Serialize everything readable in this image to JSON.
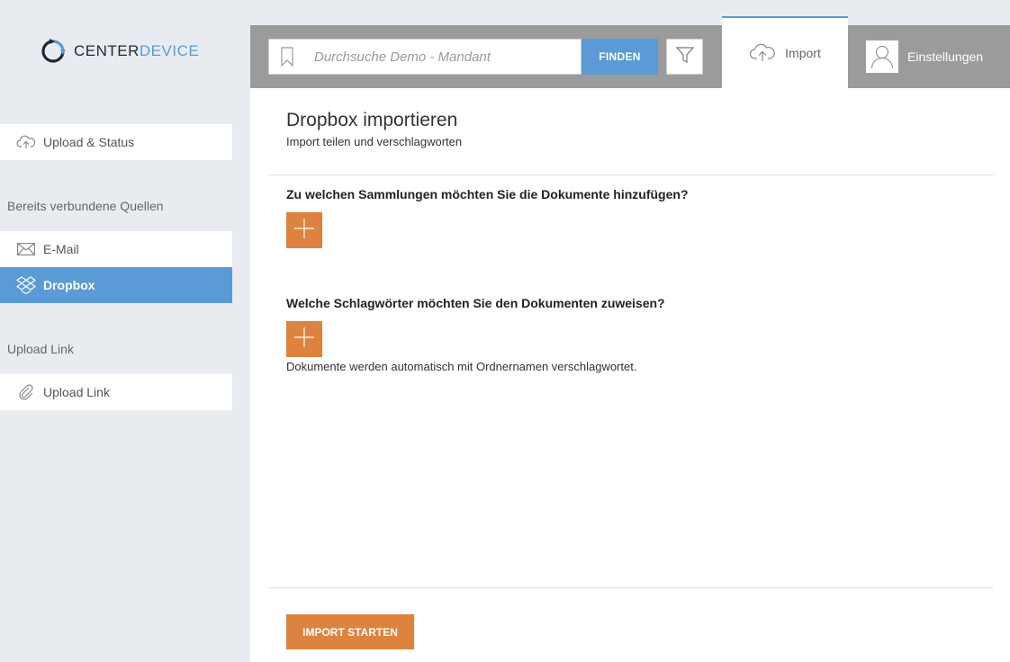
{
  "app": {
    "logo_text_a": "CENTER",
    "logo_text_b": "DEVICE",
    "accent": "#5b9bd5",
    "action": "#dd833f"
  },
  "sidebar": {
    "upload_status": "Upload & Status",
    "connected_heading": "Bereits verbundene Quellen",
    "sources": [
      {
        "label": "E-Mail",
        "icon": "envelope-icon"
      },
      {
        "label": "Dropbox",
        "icon": "dropbox-icon",
        "active": true
      }
    ],
    "upload_link_heading": "Upload Link",
    "upload_link": "Upload Link"
  },
  "topbar": {
    "search_placeholder": "Durchsuche Demo - Mandant",
    "find_label": "FINDEN",
    "import_tab": "Import",
    "settings_tab": "Einstellungen"
  },
  "main": {
    "title": "Dropbox importieren",
    "subtitle": "Import teilen und verschlagworten",
    "q_collections": "Zu welchen Sammlungen möchten Sie die Dokumente hinzufügen?",
    "q_tags": "Welche Schlagwörter möchten Sie den Dokumenten zuweisen?",
    "tags_hint": "Dokumente werden automatisch mit Ordnernamen verschlagwortet.",
    "start_label": "IMPORT STARTEN"
  }
}
